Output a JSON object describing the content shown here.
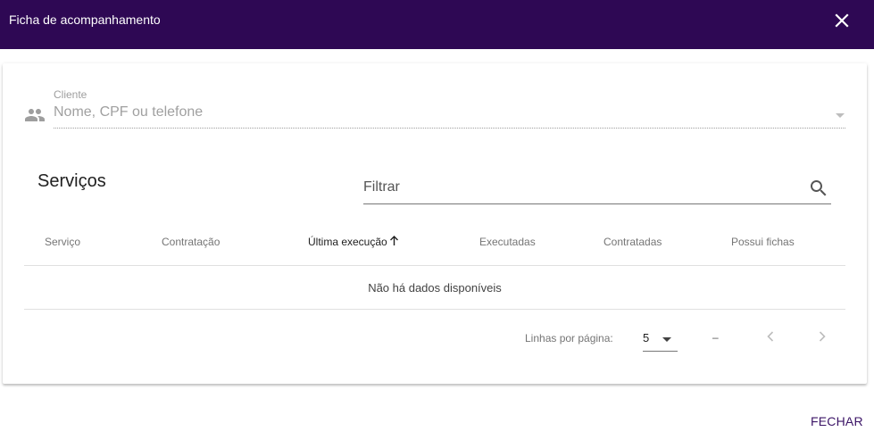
{
  "dialog": {
    "title": "Ficha de acompanhamento",
    "close_icon": "close-icon",
    "header_color": "#2e0854"
  },
  "client": {
    "label": "Cliente",
    "placeholder": "Nome, CPF ou telefone",
    "icon": "people-icon"
  },
  "services": {
    "title": "Serviços",
    "filter_label": "Filtrar",
    "filter_icon": "search-icon"
  },
  "table": {
    "columns": [
      "Serviço",
      "Contratação",
      "Última execução",
      "Executadas",
      "Contratadas",
      "Possui fichas"
    ],
    "sorted_column": "Última execução",
    "sort_direction": "ascending",
    "empty_text": "Não há dados disponíveis"
  },
  "pagination": {
    "rows_per_page_label": "Linhas por página:",
    "rows_per_page": "5",
    "range": "–"
  },
  "actions": {
    "close_label": "FECHAR",
    "accent_color": "#3b1466"
  }
}
